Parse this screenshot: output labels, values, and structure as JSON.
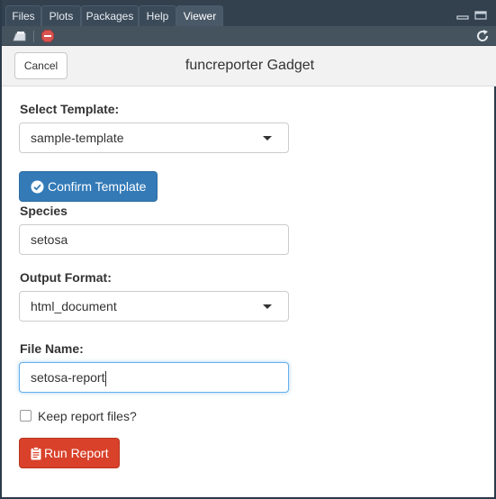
{
  "tabs": [
    {
      "label": "Files"
    },
    {
      "label": "Plots"
    },
    {
      "label": "Packages"
    },
    {
      "label": "Help"
    },
    {
      "label": "Viewer"
    }
  ],
  "active_tab": "Viewer",
  "toolbar": {
    "icons": [
      "clear-viewer-icon",
      "stop-icon",
      "refresh-icon"
    ]
  },
  "gadget": {
    "title": "funcreporter Gadget",
    "cancel_label": "Cancel"
  },
  "form": {
    "template_label": "Select Template:",
    "template_value": "sample-template",
    "confirm_label": "Confirm Template",
    "species_label": "Species",
    "species_value": "setosa",
    "format_label": "Output Format:",
    "format_value": "html_document",
    "filename_label": "File Name:",
    "filename_value": "setosa-report",
    "keep_files_label": "Keep report files?",
    "keep_files_checked": false,
    "run_label": "Run Report"
  },
  "colors": {
    "primary": "#337ab7",
    "danger": "#d9412a",
    "focus": "#66afe9"
  }
}
